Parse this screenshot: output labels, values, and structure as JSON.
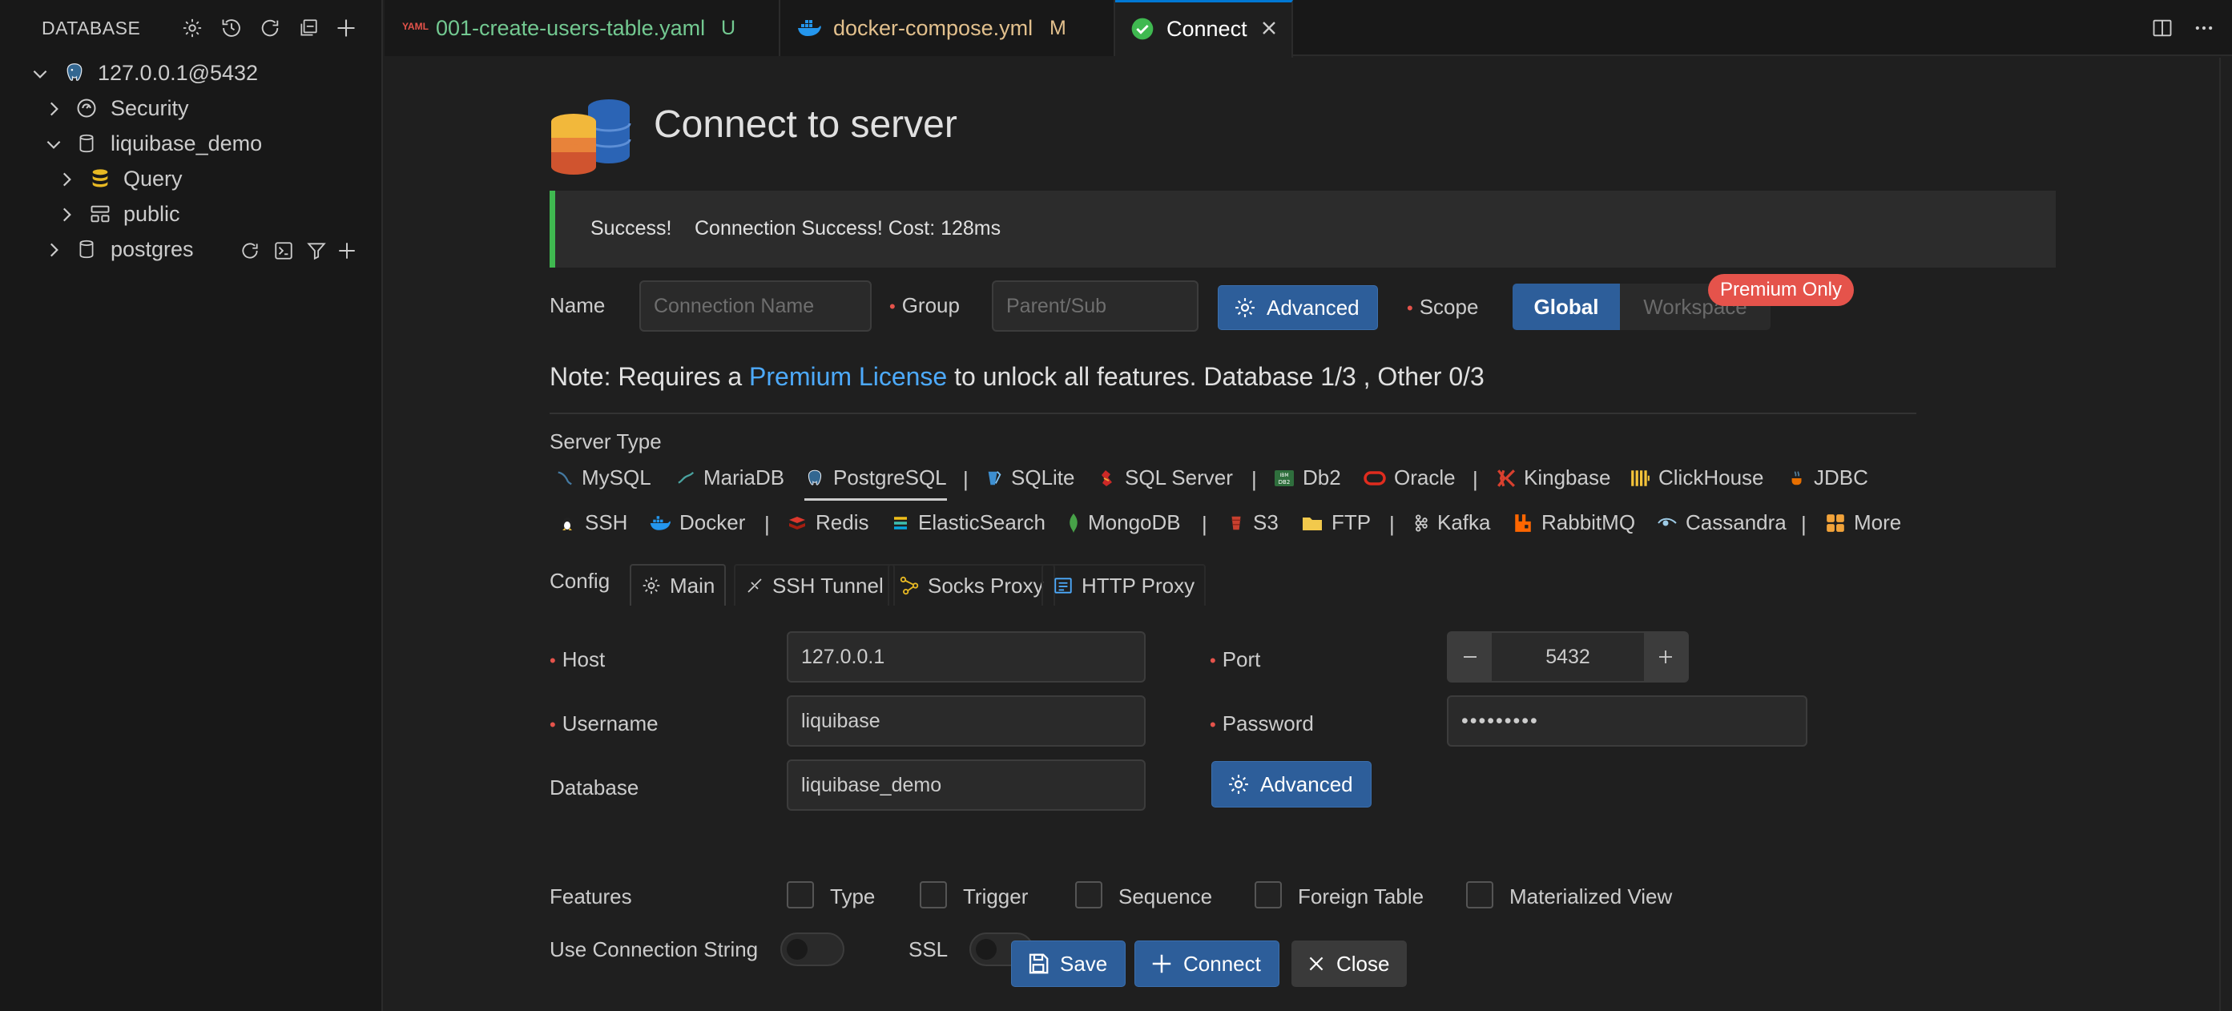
{
  "sidebar": {
    "title": "DATABASE",
    "header_icons": [
      "gear-icon",
      "history-icon",
      "refresh-icon",
      "collapse-icon",
      "add-icon"
    ],
    "tree": [
      {
        "label": "127.0.0.1@5432",
        "icon": "postgres-elephant-icon",
        "expanded": true
      },
      {
        "label": "Security",
        "icon": "shield-icon",
        "expanded": false
      },
      {
        "label": "liquibase_demo",
        "icon": "database-icon",
        "expanded": true
      },
      {
        "label": "Query",
        "icon": "query-icon",
        "expanded": false
      },
      {
        "label": "public",
        "icon": "schema-icon",
        "expanded": false
      },
      {
        "label": "postgres",
        "icon": "database-icon",
        "expanded": false
      }
    ],
    "row_actions": [
      "refresh-icon",
      "terminal-icon",
      "filter-icon",
      "add-icon"
    ]
  },
  "tabs": [
    {
      "label": "001-create-users-table.yaml",
      "badge": "U",
      "icon": "yaml-icon",
      "label_color": "#73c991",
      "badge_color": "#73c991"
    },
    {
      "label": "docker-compose.yml",
      "badge": "M",
      "icon": "docker-icon",
      "label_color": "#e2c08d",
      "badge_color": "#e2c08d"
    },
    {
      "label": "Connect",
      "badge": "",
      "icon": "check-circle-icon",
      "label_color": "#ffffff",
      "active": true
    }
  ],
  "page": {
    "title": "Connect to server",
    "alert": {
      "title": "Success!",
      "message": "Connection Success! Cost: 128ms"
    },
    "name_label": "Name",
    "name_placeholder": "Connection Name",
    "group_label": "Group",
    "group_placeholder": "Parent/Sub",
    "advanced_label": "Advanced",
    "scope_label": "Scope",
    "scope_global": "Global",
    "scope_workspace": "Workspace",
    "premium_badge": "Premium Only",
    "note_prefix": "Note: Requires a ",
    "note_link": "Premium License",
    "note_suffix": " to unlock all features. Database 1/3 , Other 0/3",
    "server_type_label": "Server Type",
    "server_types_row1": [
      "MySQL",
      "MariaDB",
      "PostgreSQL",
      "SQLite",
      "SQL Server",
      "Db2",
      "Oracle",
      "Kingbase",
      "ClickHouse",
      "JDBC"
    ],
    "server_types_row2": [
      "SSH",
      "Docker",
      "Redis",
      "ElasticSearch",
      "MongoDB",
      "S3",
      "FTP",
      "Kafka",
      "RabbitMQ",
      "Cassandra",
      "More"
    ],
    "selected_server_type": "PostgreSQL",
    "separator": "|",
    "config_label": "Config",
    "config_tabs": [
      "Main",
      "SSH Tunnel",
      "Socks Proxy",
      "HTTP Proxy"
    ],
    "host_label": "Host",
    "host_value": "127.0.0.1",
    "port_label": "Port",
    "port_value": "5432",
    "username_label": "Username",
    "username_value": "liquibase",
    "password_label": "Password",
    "password_value": "•••••••••",
    "database_label": "Database",
    "database_value": "liquibase_demo",
    "features_label": "Features",
    "features": [
      "Type",
      "Trigger",
      "Sequence",
      "Foreign Table",
      "Materialized View"
    ],
    "use_conn_string_label": "Use Connection String",
    "ssl_label": "SSL",
    "save_label": "Save",
    "connect_label": "Connect",
    "close_label": "Close"
  },
  "colors": {
    "accent": "#2d5e9a",
    "link": "#4daafc",
    "success_bar": "#3fb950",
    "required": "#e5534b",
    "premium": "#e5534b"
  }
}
